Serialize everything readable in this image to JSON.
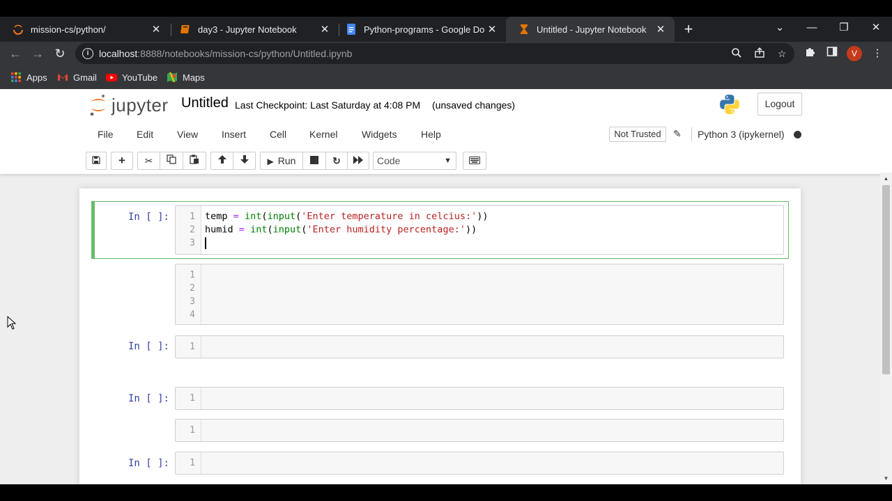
{
  "browser": {
    "tabs": [
      {
        "label": "mission-cs/python/",
        "icon": "jupyter-spinner-icon"
      },
      {
        "label": "day3 - Jupyter Notebook",
        "icon": "notebook-icon"
      },
      {
        "label": "Python-programs - Google Docs",
        "icon": "google-docs-icon"
      },
      {
        "label": "Untitled - Jupyter Notebook",
        "icon": "hourglass-icon",
        "active": true
      }
    ],
    "close_glyph": "✕",
    "new_tab_glyph": "+",
    "url_host": "localhost",
    "url_rest": ":8888/notebooks/mission-cs/python/Untitled.ipynb",
    "avatar_letter": "V",
    "bookmarks": [
      {
        "label": "Apps",
        "icon": "apps-grid-icon"
      },
      {
        "label": "Gmail",
        "icon": "gmail-icon"
      },
      {
        "label": "YouTube",
        "icon": "youtube-icon"
      },
      {
        "label": "Maps",
        "icon": "maps-icon"
      }
    ]
  },
  "jupyter": {
    "logo_text": "jupyter",
    "notebook_title": "Untitled",
    "checkpoint": "Last Checkpoint: Last Saturday at 4:08 PM",
    "status": "(unsaved changes)",
    "logout_label": "Logout",
    "menu": [
      "File",
      "Edit",
      "View",
      "Insert",
      "Cell",
      "Kernel",
      "Widgets",
      "Help"
    ],
    "trust_label": "Not Trusted",
    "kernel_name": "Python 3 (ipykernel)",
    "run_label": "Run",
    "cell_type": "Code",
    "accent_green": "#66bb6a",
    "prompt_color": "#303f9f"
  },
  "cells": [
    {
      "prompt": "In [ ]:",
      "line_numbers": [
        "1",
        "2",
        "3"
      ],
      "lines": [
        {
          "var": "temp",
          "eq": "=",
          "fn1": "int",
          "p1": "(",
          "fn2": "input",
          "p2": "(",
          "str": "'Enter temperature in celcius:'",
          "p3": "))"
        },
        {
          "var": "humid",
          "eq": "=",
          "fn1": "int",
          "p1": "(",
          "fn2": "input",
          "p2": "(",
          "str": "'Enter humidity percentage:'",
          "p3": "))"
        }
      ]
    },
    {
      "prompt": "",
      "line_numbers": [
        "1",
        "2",
        "3",
        "4"
      ]
    },
    {
      "prompt": "In [ ]:",
      "line_numbers": [
        "1"
      ]
    },
    {
      "prompt": "In [ ]:",
      "line_numbers": [
        "1"
      ]
    },
    {
      "prompt": "",
      "line_numbers": [
        "1"
      ]
    },
    {
      "prompt": "In [ ]:",
      "line_numbers": [
        "1"
      ]
    }
  ]
}
